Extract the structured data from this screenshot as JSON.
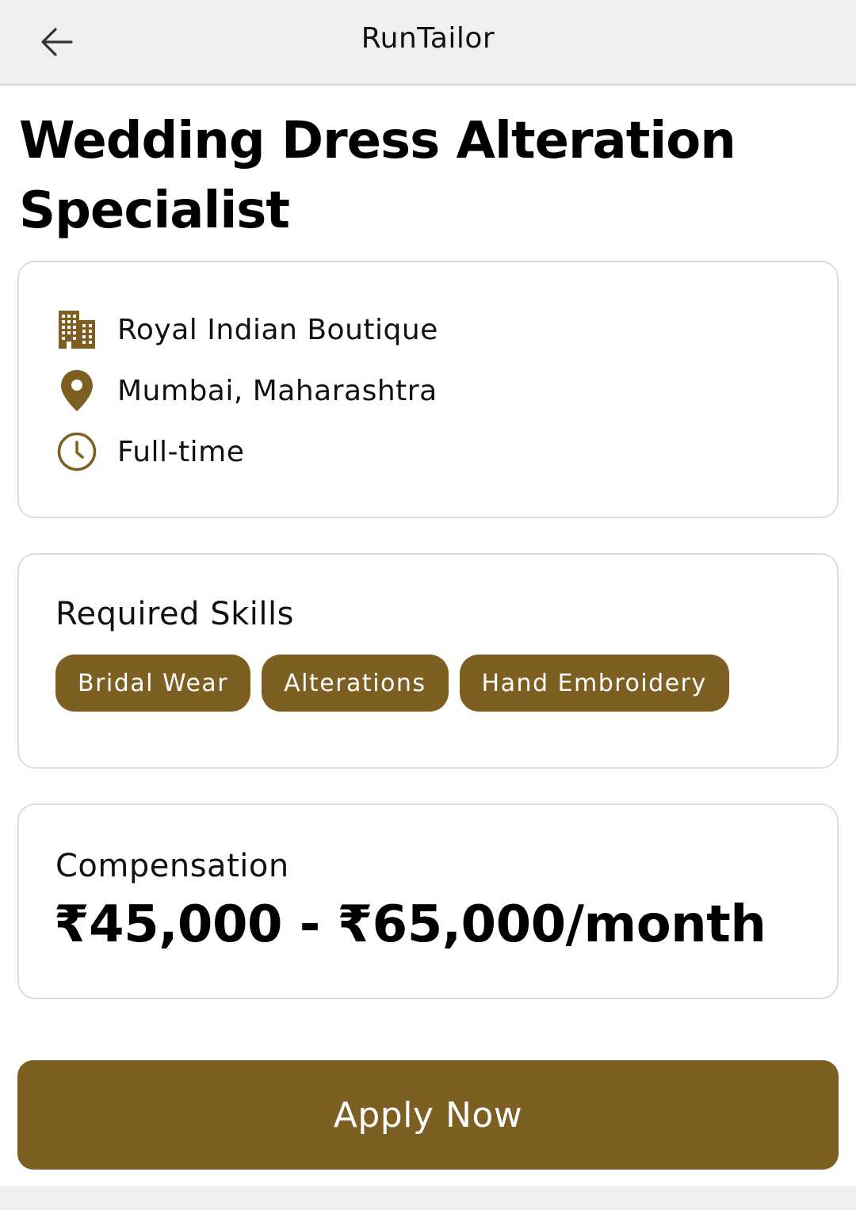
{
  "header": {
    "title": "RunTailor",
    "back_icon": "arrow-left-icon"
  },
  "job": {
    "title": "Wedding Dress Alteration Specialist",
    "company": "Royal Indian Boutique",
    "location": "Mumbai, Maharashtra",
    "employment_type": "Full-time"
  },
  "skills": {
    "label": "Required Skills",
    "items": [
      "Bridal Wear",
      "Alterations",
      "Hand Embroidery"
    ]
  },
  "compensation": {
    "label": "Compensation",
    "range": "₹45,000 - ₹65,000/month"
  },
  "actions": {
    "apply_label": "Apply Now"
  },
  "colors": {
    "accent": "#7d5f22",
    "header_bg": "#efefef",
    "card_border": "#dcdcdc"
  }
}
